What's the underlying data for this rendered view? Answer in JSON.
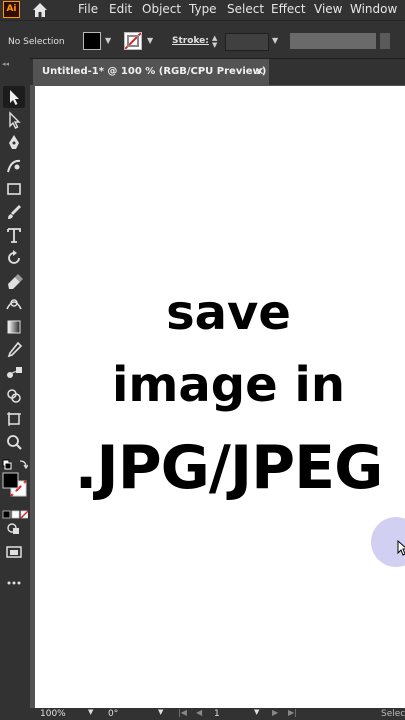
{
  "app": {
    "logo_text": "Ai"
  },
  "menu": [
    "File",
    "Edit",
    "Object",
    "Type",
    "Select",
    "Effect",
    "View",
    "Window"
  ],
  "control_bar": {
    "selection_label": "No Selection",
    "stroke_label": "Stroke:"
  },
  "document": {
    "tab_title": "Untitled-1* @ 100 % (RGB/CPU Preview)",
    "close_glyph": "✕"
  },
  "artboard_text": {
    "line1": "save",
    "line2": "image in",
    "line3": ".JPG/JPEG"
  },
  "status_bar": {
    "zoom": "100%",
    "rotation": "0°",
    "page": "1",
    "right_label": "Selec"
  },
  "colors": {
    "chrome_dark": "#323232",
    "pasteboard": "#535353",
    "artboard": "#ffffff",
    "accent_orange": "#ff9a00",
    "cursor_highlight": "#c9c7f0"
  },
  "tools": [
    "selection-tool",
    "direct-selection-tool",
    "pen-tool",
    "curvature-tool",
    "rectangle-tool",
    "paintbrush-tool",
    "type-tool",
    "rotate-tool",
    "eraser-tool",
    "width-tool",
    "gradient-tool",
    "eyedropper-tool",
    "blend-tool",
    "shape-builder-tool",
    "artboard-tool",
    "zoom-tool",
    "swap-fill-stroke",
    "fill-stroke-swatches",
    "color-mode-buttons",
    "draw-mode",
    "screen-mode",
    "edit-toolbar"
  ]
}
